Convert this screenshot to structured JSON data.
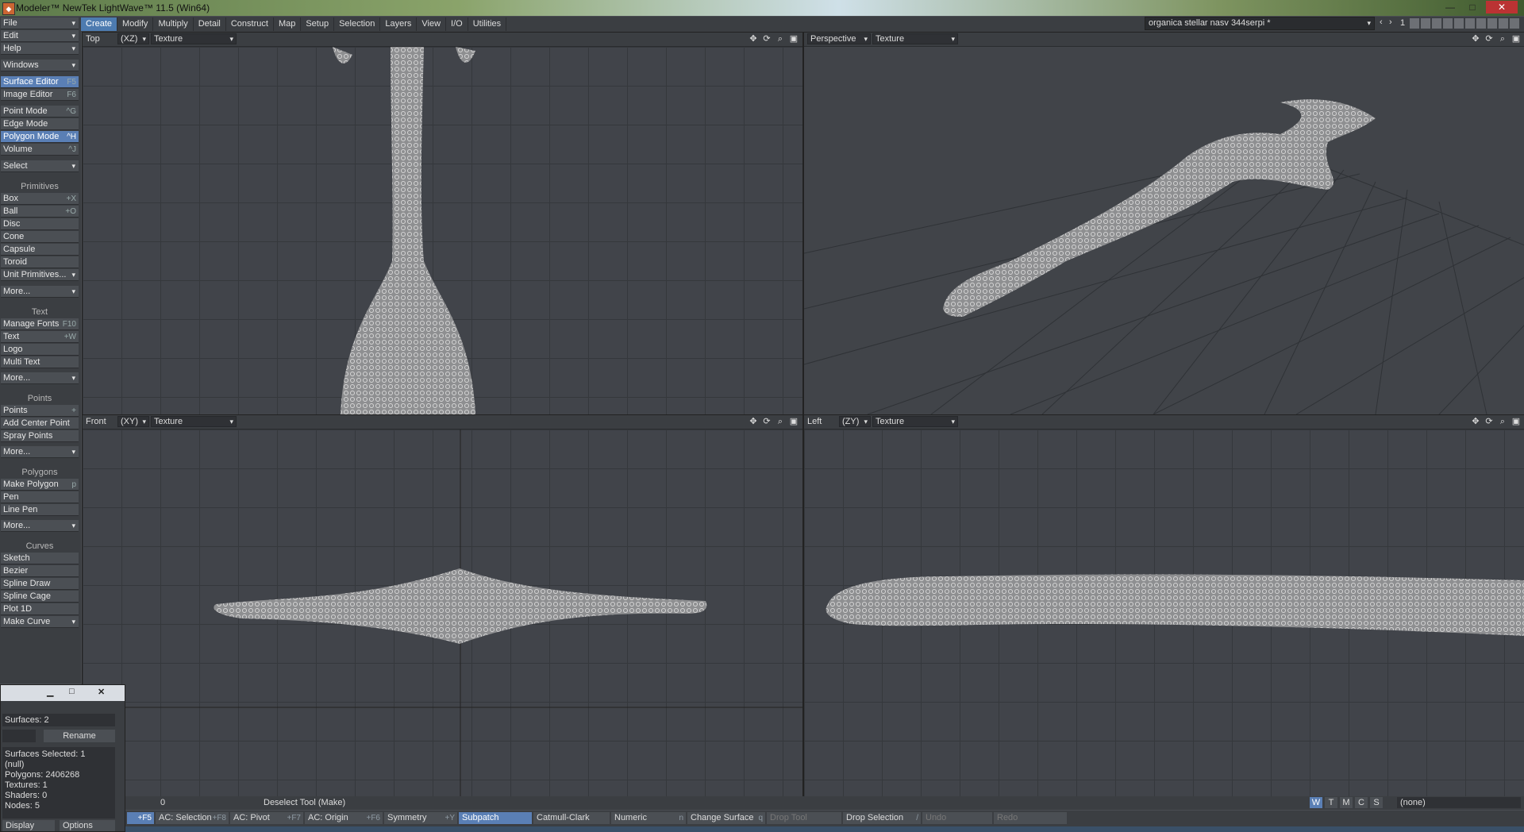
{
  "window": {
    "title": "Modeler™ NewTek LightWave™ 11.5 (Win64)",
    "minimize": "—",
    "maximize": "□",
    "close": "✕"
  },
  "menubar": {
    "tabs": [
      "Create",
      "Modify",
      "Multiply",
      "Detail",
      "Construct",
      "Map",
      "Setup",
      "Selection",
      "Layers",
      "View",
      "I/O",
      "Utilities"
    ],
    "active": "Create",
    "scene": "organica stellar nasv 344serpi *",
    "layer_number": "1"
  },
  "sidebar": {
    "file": "File",
    "edit": "Edit",
    "help": "Help",
    "windows": "Windows",
    "surface_editor": {
      "label": "Surface Editor",
      "key": "F5"
    },
    "image_editor": {
      "label": "Image Editor",
      "key": "F6"
    },
    "point_mode": {
      "label": "Point Mode",
      "key": "^G"
    },
    "edge_mode": {
      "label": "Edge Mode",
      "key": ""
    },
    "polygon_mode": {
      "label": "Polygon Mode",
      "key": "^H"
    },
    "volume": {
      "label": "Volume",
      "key": "^J"
    },
    "select": "Select",
    "primitives_header": "Primitives",
    "primitives": [
      {
        "label": "Box",
        "key": "+X"
      },
      {
        "label": "Ball",
        "key": "+O"
      },
      {
        "label": "Disc",
        "key": ""
      },
      {
        "label": "Cone",
        "key": ""
      },
      {
        "label": "Capsule",
        "key": ""
      },
      {
        "label": "Toroid",
        "key": ""
      },
      {
        "label": "Unit Primitives...",
        "key": ""
      },
      {
        "label": "More...",
        "key": ""
      }
    ],
    "text_header": "Text",
    "text": [
      {
        "label": "Manage Fonts",
        "key": "F10"
      },
      {
        "label": "Text",
        "key": "+W"
      },
      {
        "label": "Logo",
        "key": ""
      },
      {
        "label": "Multi Text",
        "key": ""
      },
      {
        "label": "More...",
        "key": ""
      }
    ],
    "points_header": "Points",
    "points": [
      {
        "label": "Points",
        "key": "+"
      },
      {
        "label": "Add Center Point",
        "key": ""
      },
      {
        "label": "Spray Points",
        "key": ""
      },
      {
        "label": "More...",
        "key": ""
      }
    ],
    "polygons_header": "Polygons",
    "polygons": [
      {
        "label": "Make Polygon",
        "key": "p"
      },
      {
        "label": "Pen",
        "key": ""
      },
      {
        "label": "Line Pen",
        "key": ""
      },
      {
        "label": "More...",
        "key": ""
      }
    ],
    "curves_header": "Curves",
    "curves": [
      {
        "label": "Sketch",
        "key": ""
      },
      {
        "label": "Bezier",
        "key": ""
      },
      {
        "label": "Spline Draw",
        "key": ""
      },
      {
        "label": "Spline Cage",
        "key": ""
      },
      {
        "label": "Plot 1D",
        "key": ""
      },
      {
        "label": "Make Curve",
        "key": ""
      }
    ]
  },
  "viewports": {
    "top": {
      "name": "Top",
      "axis": "(XZ)",
      "mode": "Texture"
    },
    "perspective": {
      "name": "Perspective",
      "mode": "Texture"
    },
    "front": {
      "name": "Front",
      "axis": "(XY)",
      "mode": "Texture"
    },
    "left": {
      "name": "Left",
      "axis": "(ZY)",
      "mode": "Texture"
    }
  },
  "surface_panel": {
    "surfaces": "Surfaces: 2",
    "rename": "Rename",
    "info": [
      "Surfaces Selected: 1",
      "(null)",
      "Polygons: 2406268",
      "Textures: 1",
      "Shaders: 0",
      "Nodes: 5"
    ],
    "display": "Display",
    "options": "Options"
  },
  "statusbar": {
    "value": "0",
    "message": "Deselect Tool (Make)",
    "layer_flags": [
      "W",
      "T",
      "M",
      "C",
      "S"
    ],
    "vmap": "(none)"
  },
  "bottombar": [
    {
      "label": "",
      "key": "+F5"
    },
    {
      "label": "AC: Selection",
      "key": "+F8"
    },
    {
      "label": "AC: Pivot",
      "key": "+F7"
    },
    {
      "label": "AC: Origin",
      "key": "+F6"
    },
    {
      "label": "Symmetry",
      "key": "+Y"
    },
    {
      "label": "Subpatch",
      "key": ""
    },
    {
      "label": "Catmull-Clark",
      "key": ""
    },
    {
      "label": "Numeric",
      "key": "n"
    },
    {
      "label": "Change Surface",
      "key": "q"
    },
    {
      "label": "Drop Tool",
      "key": ""
    },
    {
      "label": "Drop Selection",
      "key": "/"
    },
    {
      "label": "Undo",
      "key": ""
    },
    {
      "label": "Redo",
      "key": ""
    }
  ]
}
